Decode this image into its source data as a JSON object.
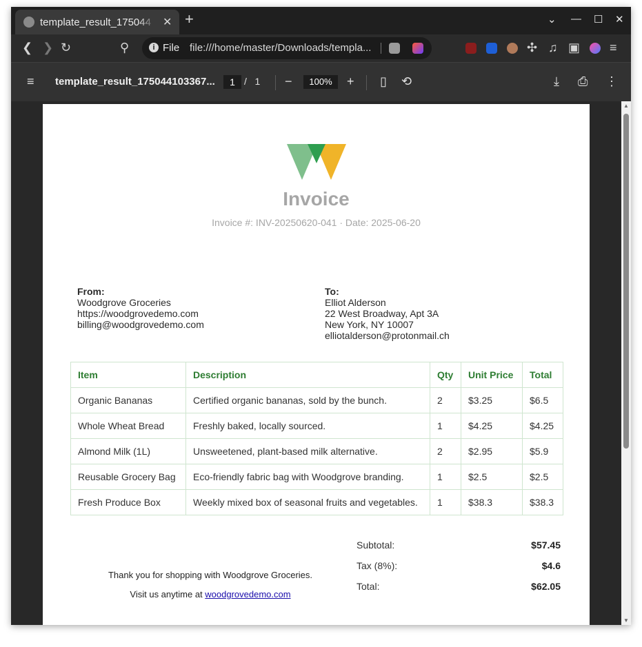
{
  "browser": {
    "tab_title": "template_result_175044",
    "new_tab": "+",
    "url_scheme": "File",
    "url": "file:///home/master/Downloads/templa...",
    "win_minimize": "—",
    "win_maximize": "☐",
    "win_close": "✕"
  },
  "pdf_viewer": {
    "title": "template_result_175044103367...",
    "page_current": "1",
    "page_total": "/   1",
    "zoom": "100%"
  },
  "invoice": {
    "title": "Invoice",
    "meta": "Invoice #: INV-20250620-041 · Date: 2025-06-20",
    "from": {
      "label": "From:",
      "lines": [
        "Woodgrove Groceries",
        "https://woodgrovedemo.com",
        "billing@woodgrovedemo.com"
      ]
    },
    "to": {
      "label": "To:",
      "lines": [
        "Elliot Alderson",
        "22 West Broadway, Apt 3A",
        "New York, NY 10007",
        "elliotalderson@protonmail.ch"
      ]
    },
    "table": {
      "headers": [
        "Item",
        "Description",
        "Qty",
        "Unit Price",
        "Total"
      ],
      "rows": [
        [
          "Organic Bananas",
          "Certified organic bananas, sold by the bunch.",
          "2",
          "$3.25",
          "$6.5"
        ],
        [
          "Whole Wheat Bread",
          "Freshly baked, locally sourced.",
          "1",
          "$4.25",
          "$4.25"
        ],
        [
          "Almond Milk (1L)",
          "Unsweetened, plant-based milk alternative.",
          "2",
          "$2.95",
          "$5.9"
        ],
        [
          "Reusable Grocery Bag",
          "Eco-friendly fabric bag with Woodgrove branding.",
          "1",
          "$2.5",
          "$2.5"
        ],
        [
          "Fresh Produce Box",
          "Weekly mixed box of seasonal fruits and vegetables.",
          "1",
          "$38.3",
          "$38.3"
        ]
      ]
    },
    "totals": {
      "subtotal_label": "Subtotal:",
      "subtotal": "$57.45",
      "tax_label": "Tax (8%):",
      "tax": "$4.6",
      "total_label": "Total:",
      "total": "$62.05"
    },
    "footer": {
      "thanks": "Thank you for shopping with Woodgrove Groceries.",
      "visit_prefix": "Visit us anytime at ",
      "visit_link": "woodgrovedemo.com"
    }
  },
  "colors": {
    "accent_green": "#2e7d32",
    "logo_light_green": "#7fbf8c",
    "logo_green": "#2e9e4f",
    "logo_yellow": "#f0b429"
  }
}
